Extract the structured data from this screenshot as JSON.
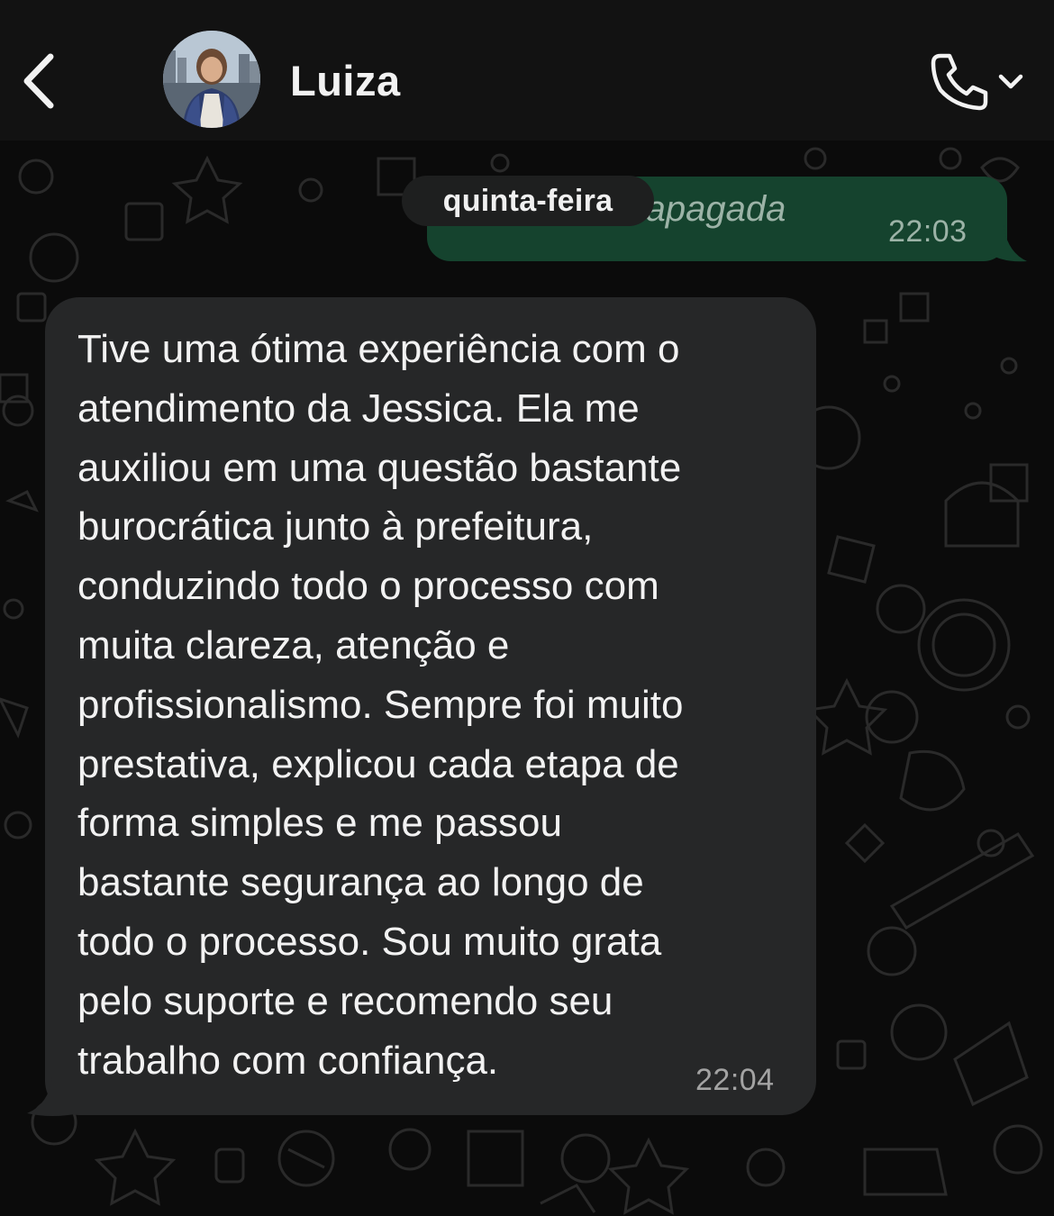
{
  "header": {
    "contact_name": "Luiza",
    "back_icon": "chevron-left-icon",
    "call_icon": "phone-icon",
    "call_menu_icon": "chevron-down-icon"
  },
  "date_separator": "quinta-feira",
  "messages": [
    {
      "direction": "outgoing",
      "deleted": true,
      "visible_text": "em apagada",
      "time": "22:03"
    },
    {
      "direction": "incoming",
      "lines": [
        "Tive uma ótima experiência com o",
        "atendimento da Jessica. Ela me",
        "auxiliou em uma questão bastante",
        "burocrática junto à prefeitura,",
        "conduzindo todo o processo com",
        "muita clareza, atenção e",
        "profissionalismo. Sempre foi muito",
        "prestativa, explicou cada etapa de",
        "forma simples e me passou",
        "bastante segurança ao longo de",
        "todo o processo. Sou muito grata",
        "pelo suporte e recomendo seu",
        "trabalho com confiança."
      ],
      "time": "22:04"
    }
  ],
  "colors": {
    "background": "#0b0b0b",
    "header": "#121212",
    "outgoing_bubble": "#15432e",
    "incoming_bubble": "#262728",
    "date_chip": "#1e1f1f"
  }
}
